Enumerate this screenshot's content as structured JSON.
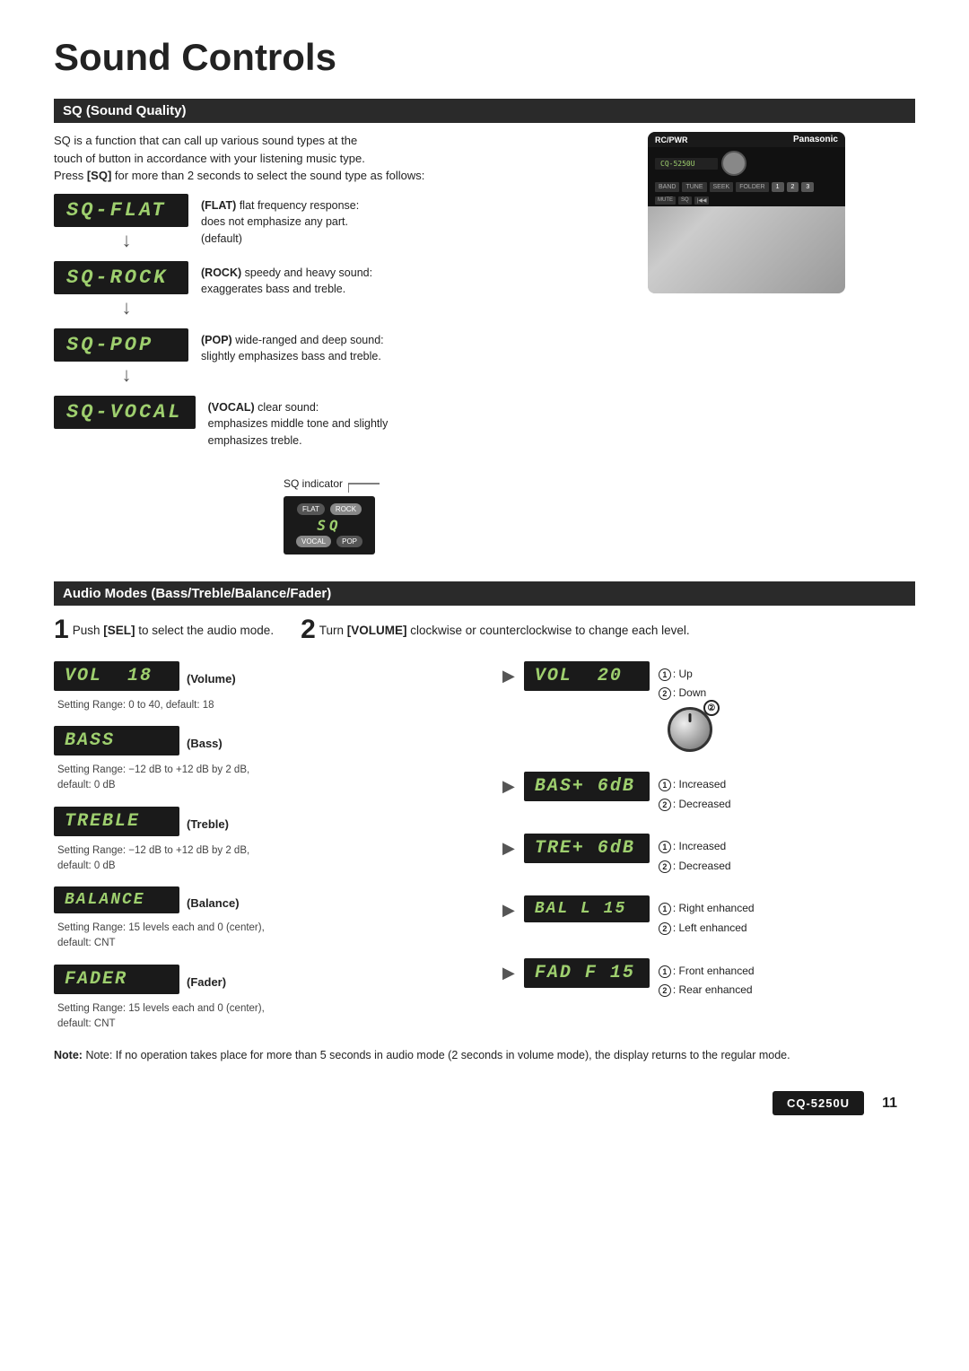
{
  "page": {
    "title": "Sound Controls",
    "model": "CQ-5250U",
    "page_number": "11"
  },
  "sq_section": {
    "header": "SQ (Sound Quality)",
    "intro_line1": "SQ is a function that can call up various sound types at the",
    "intro_line2": "touch of button in accordance with your listening music type.",
    "intro_line3": "Press [SQ] for more than 2 seconds to select the sound type as follows:",
    "modes": [
      {
        "display": "SQ-FLAT",
        "label": "FLAT",
        "desc": "flat frequency response: does not emphasize any part. (default)"
      },
      {
        "display": "SQ-ROCK",
        "label": "ROCK",
        "desc": "speedy and heavy sound: exaggerates bass and treble."
      },
      {
        "display": "SQ-POP",
        "label": "POP",
        "desc": "wide-ranged and deep sound: slightly emphasizes bass and treble."
      },
      {
        "display": "SQ-VOCAL",
        "label": "VOCAL",
        "desc": "clear sound: emphasizes middle tone and slightly emphasizes treble."
      }
    ],
    "indicator_label": "SQ indicator"
  },
  "audio_section": {
    "header": "Audio Modes (Bass/Treble/Balance/Fader)",
    "step1_label": "1",
    "step1_text": "Push [SEL] to select the audio mode.",
    "step2_label": "2",
    "step2_text": "Turn [VOLUME] clockwise or counterclockwise to change each level.",
    "modes": [
      {
        "display_before": "VOL  18",
        "label": "Volume",
        "setting": "Setting Range: 0 to 40, default: 18",
        "display_after": "VOL  20",
        "option1": "Up",
        "option2": "Down"
      },
      {
        "display_before": "BASS",
        "label": "Bass",
        "setting": "Setting Range: -12 dB to +12 dB by 2 dB, default: 0 dB",
        "display_after": "BAS+ 6dB",
        "option1": "Increased",
        "option2": "Decreased"
      },
      {
        "display_before": "TREBLE",
        "label": "Treble",
        "setting": "Setting Range: -12 dB to +12 dB by 2 dB, default: 0 dB",
        "display_after": "TRE+ 6dB",
        "option1": "Increased",
        "option2": "Decreased"
      },
      {
        "display_before": "BALANCE",
        "label": "Balance",
        "setting": "Setting Range: 15 levels each and 0 (center), default: CNT",
        "display_after": "BAL L 15",
        "option1": "Right enhanced",
        "option2": "Left enhanced"
      },
      {
        "display_before": "FADER",
        "label": "Fader",
        "setting": "Setting Range: 15 levels each and 0 (center), default: CNT",
        "display_after": "FAD F 15",
        "option1": "Front enhanced",
        "option2": "Rear enhanced"
      }
    ],
    "note": "Note: If no operation takes place for more than 5 seconds in audio mode (2 seconds in volume mode), the display returns to the regular mode."
  }
}
